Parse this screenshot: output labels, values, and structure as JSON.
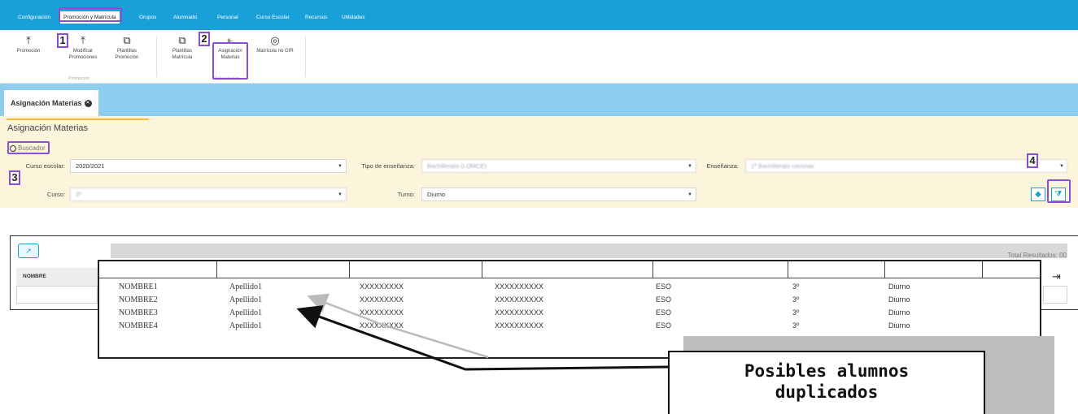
{
  "menu": {
    "items": [
      "Configuración",
      "Promoción y Matrícula",
      "Grupos",
      "Alumnado",
      "Personal",
      "Curso Escolar",
      "Recursos",
      "Utilidades"
    ]
  },
  "ribbon": {
    "buttons": [
      {
        "label": "Promoción",
        "icon": "upload-icon"
      },
      {
        "label": "Modificar Promociones",
        "icon": "upload-icon"
      },
      {
        "label": "Plantillas Promoción",
        "icon": "copy-icon"
      },
      {
        "label": "Plantillas Matrícula",
        "icon": "copy-icon"
      },
      {
        "label": "Asignación Materias",
        "icon": "tree-icon"
      },
      {
        "label": "Matrícula no GIR",
        "icon": "fingerprint-icon"
      }
    ],
    "groups": [
      "Promoción",
      "Matriculación"
    ]
  },
  "tab": {
    "label": "Asignación Materias"
  },
  "panel": {
    "title": "Asignación Materias",
    "buscador": "Buscador",
    "labels": {
      "curso_escolar": "Curso escolar:",
      "tipo_ensenanza": "Tipo de enseñanza:",
      "ensenanza": "Enseñanza:",
      "curso": "Curso:",
      "turno": "Turno:"
    },
    "values": {
      "curso_escolar": "2020/2021",
      "tipo_ensenanza": "Bachillerato (LOMCE)",
      "ensenanza": "1º Bachillerato ciencias",
      "curso": "3º",
      "turno": "Diurno"
    }
  },
  "annotations": {
    "n1": "1",
    "n2": "2",
    "n3": "3",
    "n4": "4"
  },
  "grid": {
    "total_label": "Total Resultados: 00",
    "column_nombre": "NOMBRE"
  },
  "overlay": {
    "rows": [
      [
        "NOMBRE1",
        "Apellido1",
        "XXXXXXXXX",
        "XXXXXXXXXX",
        "ESO",
        "3º",
        "Diurno"
      ],
      [
        "NOMBRE2",
        "Apellido1",
        "XXXXXXXXX",
        "XXXXXXXXXX",
        "ESO",
        "3º",
        "Diurno"
      ],
      [
        "NOMBRE3",
        "Apellido1",
        "XXXXXXXXX",
        "XXXXXXXXXX",
        "ESO",
        "3º",
        "Diurno"
      ],
      [
        "NOMBRE4",
        "Apellido1",
        "XXXXXXXXX",
        "XXXXXXXXXX",
        "ESO",
        "3º",
        "Diurno"
      ]
    ]
  },
  "callout": {
    "line1": "Posibles alumnos",
    "line2": "duplicados"
  },
  "colors": {
    "accent": "#1aa0d8",
    "highlight": "#8a4fd1",
    "panel": "#fdf4dc",
    "tabbar": "#8fcdee"
  }
}
